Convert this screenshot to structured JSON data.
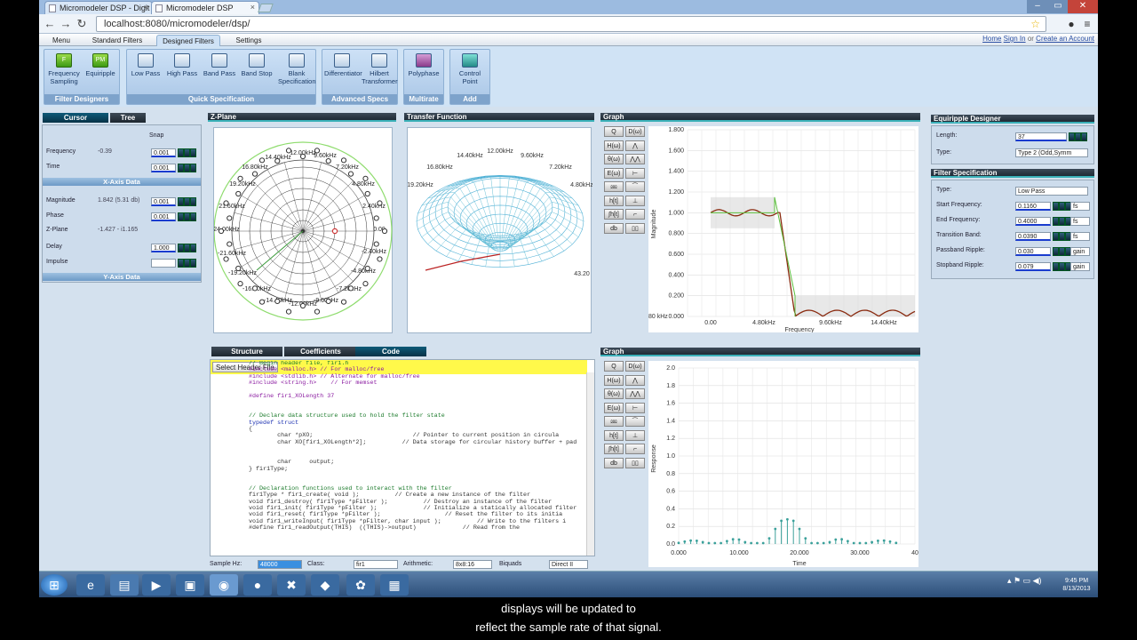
{
  "browser": {
    "tabs": [
      {
        "title": "Micromodeler DSP - Digit"
      },
      {
        "title": "Micromodeler DSP"
      }
    ],
    "url": "localhost:8080/micromodeler/dsp/"
  },
  "menu": {
    "tabs": [
      "Menu",
      "Standard Filters",
      "Designed Filters",
      "Settings"
    ],
    "links": {
      "home": "Home",
      "sign_in": "Sign In",
      "or": "or",
      "create": "Create an Account"
    }
  },
  "ribbon": {
    "groups": [
      {
        "label": "Filter Designers",
        "buttons": [
          "Frequency Sampling",
          "Equiripple"
        ]
      },
      {
        "label": "Quick Specification",
        "buttons": [
          "Low Pass",
          "High Pass",
          "Band Pass",
          "Band Stop",
          "Blank Specification"
        ]
      },
      {
        "label": "Advanced Specs",
        "buttons": [
          "Differentiator",
          "Hilbert Transformer"
        ]
      },
      {
        "label": "Multirate",
        "buttons": [
          "Polyphase"
        ]
      },
      {
        "label": "Add",
        "buttons": [
          "Control Point"
        ]
      }
    ],
    "icon_text": {
      "freq": "F",
      "eq": "PM"
    }
  },
  "cursor_panel": {
    "tabs": [
      "Cursor",
      "Tree"
    ],
    "snap": "Snap",
    "rows": [
      {
        "label": "Frequency",
        "value": "-0.39",
        "input": "0.001"
      },
      {
        "label": "Time",
        "value": "",
        "input": "0.001"
      }
    ],
    "x_header": "X-Axis Data",
    "yrows": [
      {
        "label": "Magnitude",
        "value": "1.842 (5.31 db)",
        "input": "0.001"
      },
      {
        "label": "Phase",
        "value": "",
        "input": "0.001"
      },
      {
        "label": "Z-Plane",
        "value": "-1.427 - i1.165",
        "input": ""
      },
      {
        "label": "Delay",
        "value": "",
        "input": "1.000"
      },
      {
        "label": "Impulse",
        "value": "",
        "input": ""
      }
    ],
    "y_header": "Y-Axis Data"
  },
  "zplane": {
    "title": "Z-Plane",
    "labels": [
      "12.00kHz",
      "14.40kHz",
      "9.60kHz",
      "16.80kHz",
      "7.20kHz",
      "19.20kHz",
      "4.80kHz",
      "21.60kHz",
      "2.40kHz",
      "24.00kHz",
      "0.00",
      "-21.60kHz",
      "-2.40kHz",
      "-19.20kHz",
      "-4.80kHz",
      "-16.80kHz",
      "-7.20kHz",
      "-14.40kHz",
      "-9.60kHz",
      "-12.00kHz"
    ]
  },
  "transfer": {
    "title": "Transfer Function",
    "labels": [
      "12.00kHz",
      "14.40kHz",
      "9.60kHz",
      "16.80kHz",
      "7.20kHz",
      "19.20kHz",
      "4.80kHz",
      "43.20"
    ]
  },
  "graph1": {
    "title": "Graph",
    "tools": [
      "Q",
      "D(ω)",
      "H(ω)",
      "θ(ω)",
      "E(ω)",
      "h[t]",
      "∫h[t]",
      "db"
    ],
    "ylabel": "Magnitude",
    "xlabel": "Frequency",
    "yticks": [
      "1.800",
      "1.600",
      "1.400",
      "1.200",
      "1.000",
      "0.800",
      "0.600",
      "0.400",
      "0.200",
      "0.000"
    ],
    "xticks": [
      "0.00",
      "4.80kHz",
      "9.60kHz",
      "14.40kHz"
    ],
    "leftlabel": "80 kHz"
  },
  "graph2": {
    "title": "Graph",
    "ylabel": "Response",
    "xlabel": "Time",
    "yticks": [
      "2.0",
      "1.8",
      "1.6",
      "1.4",
      "1.2",
      "1.0",
      "0.8",
      "0.6",
      "0.4",
      "0.2",
      "0.0"
    ],
    "xticks": [
      "0.000",
      "10.000",
      "20.000",
      "30.000",
      "40"
    ]
  },
  "code_tabs": [
    "Structure",
    "Coefficients",
    "Code"
  ],
  "select_header": "Select Header File",
  "code_lines": [
    {
      "c": "cm",
      "t": "// Begin header file, fir1.h"
    },
    {
      "c": "pp",
      "t": "#include <malloc.h> // For malloc/free"
    },
    {
      "c": "pp",
      "t": "#include <stdlib.h> // Alternate for malloc/free"
    },
    {
      "c": "pp",
      "t": "#include <string.h>    // For memset"
    },
    {
      "c": "",
      "t": ""
    },
    {
      "c": "pp",
      "t": "#define fir1_XOLength 37"
    },
    {
      "c": "",
      "t": ""
    },
    {
      "c": "",
      "t": ""
    },
    {
      "c": "cm",
      "t": "// Declare data structure used to hold the filter state"
    },
    {
      "c": "kw",
      "t": "typedef struct"
    },
    {
      "c": "",
      "t": "{"
    },
    {
      "c": "",
      "t": "        char *pXO;                            // Pointer to current position in circula"
    },
    {
      "c": "",
      "t": "        char XO[fir1_XOLength*2];          // Data storage for circular history buffer + pad"
    },
    {
      "c": "",
      "t": ""
    },
    {
      "c": "",
      "t": ""
    },
    {
      "c": "",
      "t": "        char     output;"
    },
    {
      "c": "",
      "t": "} fir1Type;"
    },
    {
      "c": "",
      "t": ""
    },
    {
      "c": "",
      "t": ""
    },
    {
      "c": "cm",
      "t": "// Declaration functions used to interact with the filter"
    },
    {
      "c": "",
      "t": "fir1Type * fir1_create( void );          // Create a new instance of the filter"
    },
    {
      "c": "",
      "t": "void fir1_destroy( fir1Type *pFilter );          // Destroy an instance of the filter"
    },
    {
      "c": "",
      "t": "void fir1_init( fir1Type *pFilter );             // Initialize a statically allocated filter"
    },
    {
      "c": "",
      "t": "void fir1_reset( fir1Type *pFilter );                  // Reset the filter to its initia"
    },
    {
      "c": "",
      "t": "void fir1_writeInput( fir1Type *pFilter, char input );          // Write to the filters i"
    },
    {
      "c": "",
      "t": "#define fir1_readOutput(THIS)  ((THIS)->output)             // Read from the"
    }
  ],
  "bottom_bar": {
    "sample_label": "Sample Hz:",
    "sample_value": "48000",
    "class_label": "Class:",
    "class_value": "fir1",
    "arith_label": "Arithmetic:",
    "arith_value": "8x8:16",
    "biquads_label": "Biquads",
    "structure_value": "Direct II"
  },
  "equiripple": {
    "title": "Equiripple Designer",
    "length_label": "Length:",
    "length_value": "37",
    "type_label": "Type:",
    "type_value": "Type 2 (Odd,Symm"
  },
  "filterspec": {
    "title": "Filter Specification",
    "rows": [
      {
        "label": "Type:",
        "value": "Low Pass",
        "unit": ""
      },
      {
        "label": "Start Frequency:",
        "value": "0.1160",
        "unit": "fs"
      },
      {
        "label": "End Frequency:",
        "value": "0.4000",
        "unit": "fs"
      },
      {
        "label": "Transition Band:",
        "value": "0.0390",
        "unit": "fs"
      },
      {
        "label": "Passband Ripple:",
        "value": "0.030",
        "unit": "gain"
      },
      {
        "label": "Stopband Ripple:",
        "value": "0.079",
        "unit": "gain"
      }
    ]
  },
  "taskbar": {
    "time": "9:45 PM",
    "date": "8/13/2013"
  },
  "subtitle": [
    "displays will be updated to",
    "reflect the sample rate of that signal."
  ]
}
